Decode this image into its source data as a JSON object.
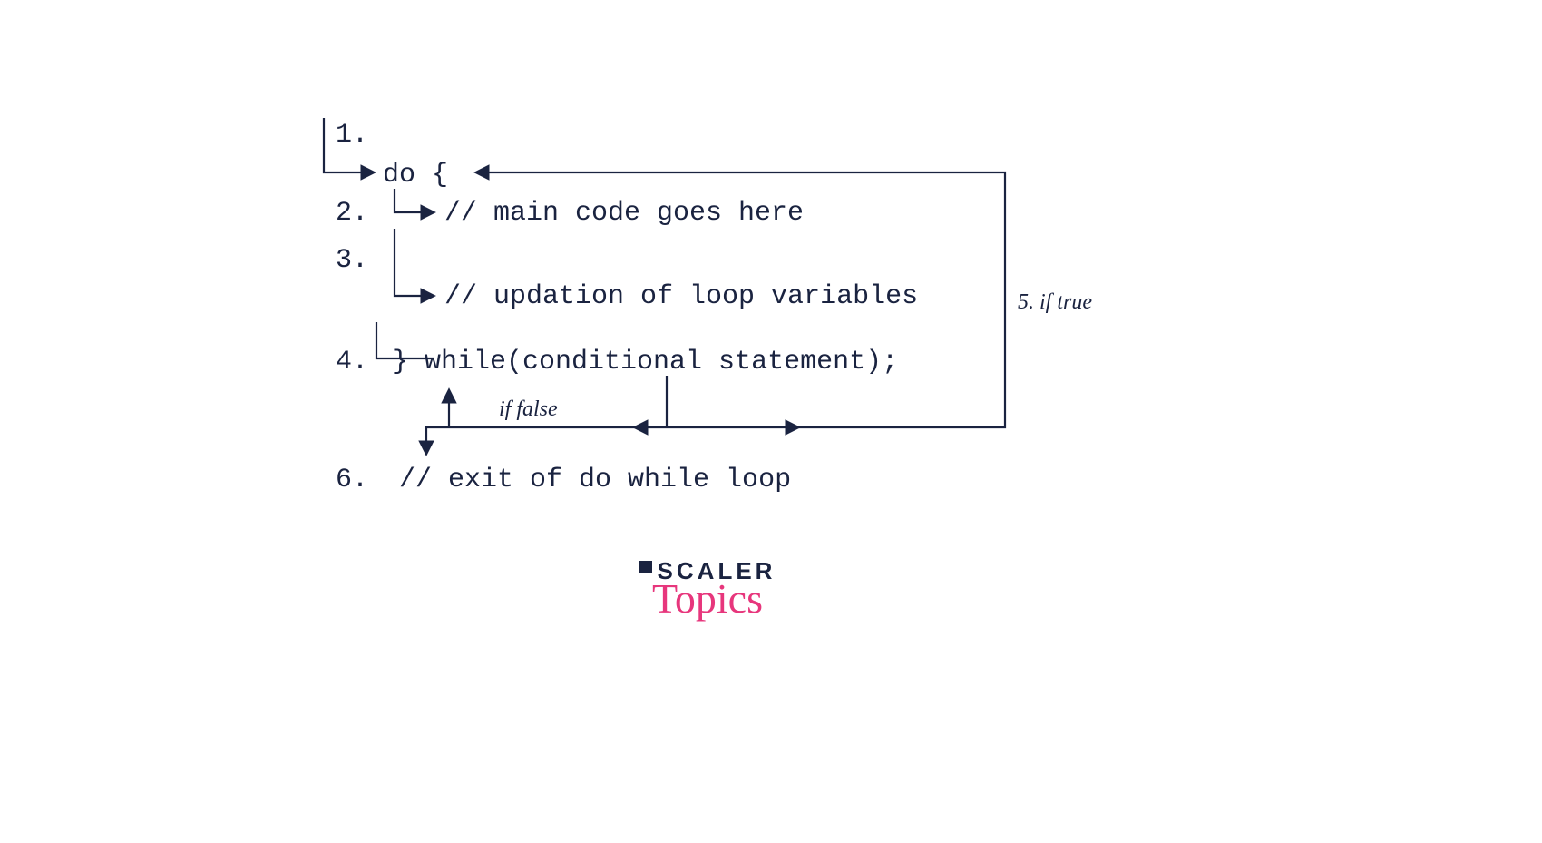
{
  "lines": {
    "n1": "1.",
    "n2": "2.",
    "n3": "3.",
    "n4": "4.",
    "n6": "6.",
    "do": "do {",
    "main": "// main code goes here",
    "update": "// updation of loop variables",
    "while": "} while(conditional statement);",
    "exit": "// exit of do while loop"
  },
  "annotations": {
    "true": "5. if true",
    "false": "if false"
  },
  "logo": {
    "scaler": "SCALER",
    "topics": "Topics"
  }
}
